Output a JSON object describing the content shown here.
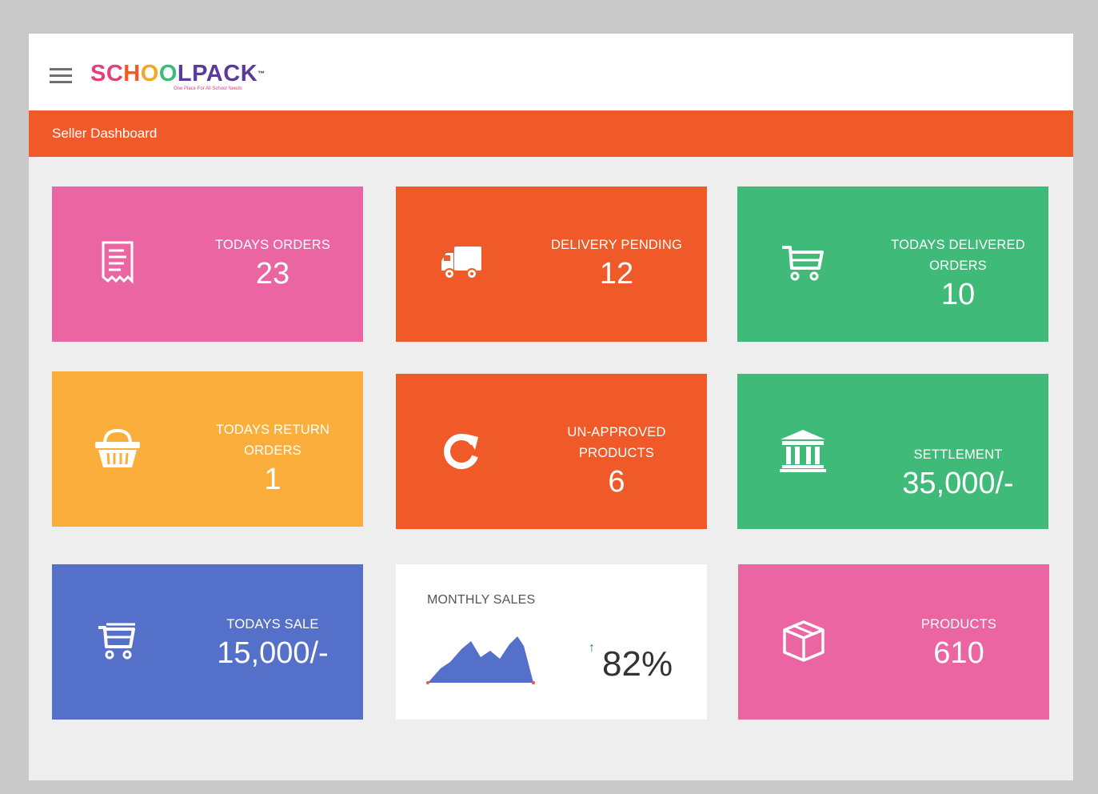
{
  "header": {
    "logo_text": "SCHOOLPACK",
    "logo_trademark": "™",
    "logo_tagline": "One Place For All School Needs"
  },
  "page": {
    "title": "Seller Dashboard"
  },
  "cards": {
    "todays_orders": {
      "label": "TODAYS ORDERS",
      "value": "23",
      "icon": "receipt-icon",
      "color": "#ea65a2"
    },
    "delivery_pending": {
      "label": "DELIVERY PENDING",
      "value": "12",
      "icon": "truck-icon",
      "color": "#f05a28"
    },
    "todays_delivered": {
      "label": "TODAYS DELIVERED ORDERS",
      "value": "10",
      "icon": "cart-icon",
      "color": "#3fba78"
    },
    "todays_return": {
      "label": "TODAYS RETURN ORDERS",
      "value": "1",
      "icon": "basket-icon",
      "color": "#fbae3c"
    },
    "unapproved": {
      "label": "UN-APPROVED PRODUCTS",
      "value": "6",
      "icon": "refresh-icon",
      "color": "#f05a28"
    },
    "settlement": {
      "label": "SETTLEMENT",
      "value": "35,000/-",
      "icon": "bank-icon",
      "color": "#3fba78"
    },
    "todays_sale": {
      "label": "TODAYS SALE",
      "value": "15,000/-",
      "icon": "cart-icon",
      "color": "#5570c8"
    },
    "monthly_sales": {
      "label": "MONTHLY SALES",
      "value": "82%",
      "trend": "up"
    },
    "products": {
      "label": "PRODUCTS",
      "value": "610",
      "icon": "box-icon",
      "color": "#ea65a2"
    }
  },
  "colors": {
    "accent": "#f05a28",
    "background": "#eeeeee"
  }
}
